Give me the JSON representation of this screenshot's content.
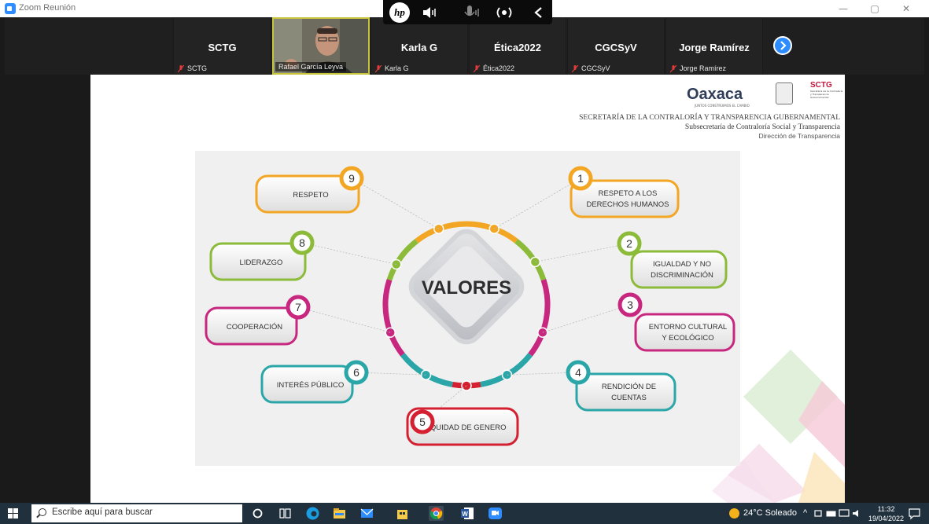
{
  "window": {
    "title": "Zoom Reunión"
  },
  "participants": [
    {
      "name": "SCTG",
      "label": "SCTG",
      "video": false
    },
    {
      "name": "",
      "label": "Rafael García Leyva",
      "video": true
    },
    {
      "name": "Karla G",
      "label": "Karla G",
      "video": false
    },
    {
      "name": "Ética2022",
      "label": "Ética2022",
      "video": false
    },
    {
      "name": "CGCSyV",
      "label": "CGCSyV",
      "video": false
    },
    {
      "name": "Jorge Ramírez",
      "label": "Jorge Ramírez",
      "video": false
    }
  ],
  "slide": {
    "logo_text": "Oaxaca",
    "logo_sub": "JUNTOS CONSTRUIMOS EL CAMBIO",
    "sctg_title": "SCTG",
    "sctg_sub": "Secretaría de la Contraloría y Transparencia Gubernamental",
    "header_line1": "SECRETARÍA DE LA CONTRALORÍA Y TRANSPARENCIA GUBERNAMENTAL",
    "header_line2": "Subsecretaría de Contraloría Social y Transparencia",
    "header_line3": "Dirección de Transparencia",
    "center_title": "VALORES",
    "values": [
      {
        "num": "1",
        "label1": "RESPETO A LOS",
        "label2": "DERECHOS HUMANOS",
        "color": "#f2a623"
      },
      {
        "num": "2",
        "label1": "IGUALDAD Y NO",
        "label2": "DISCRIMINACIÓN",
        "color": "#8cbb3a"
      },
      {
        "num": "3",
        "label1": "ENTORNO CULTURAL",
        "label2": "Y ECOLÓGICO",
        "color": "#c8277f"
      },
      {
        "num": "4",
        "label1": "RENDICIÓN DE",
        "label2": "CUENTAS",
        "color": "#2aa6a8"
      },
      {
        "num": "5",
        "label1": "EQUIDAD DE GENERO",
        "label2": "",
        "color": "#d42030"
      },
      {
        "num": "6",
        "label1": "INTERÉS PÚBLICO",
        "label2": "",
        "color": "#2aa6a8"
      },
      {
        "num": "7",
        "label1": "COOPERACIÓN",
        "label2": "",
        "color": "#c8277f"
      },
      {
        "num": "8",
        "label1": "LIDERAZGO",
        "label2": "",
        "color": "#8cbb3a"
      },
      {
        "num": "9",
        "label1": "RESPETO",
        "label2": "",
        "color": "#f2a623"
      }
    ]
  },
  "taskbar": {
    "search_placeholder": "Escribe aquí para buscar",
    "weather": "24°C Soleado",
    "time": "11:32",
    "date": "19/04/2022"
  },
  "colors": {
    "zoom_blue": "#2d8cff",
    "taskbar": "#20303d",
    "strip": "#1f1f1f"
  }
}
